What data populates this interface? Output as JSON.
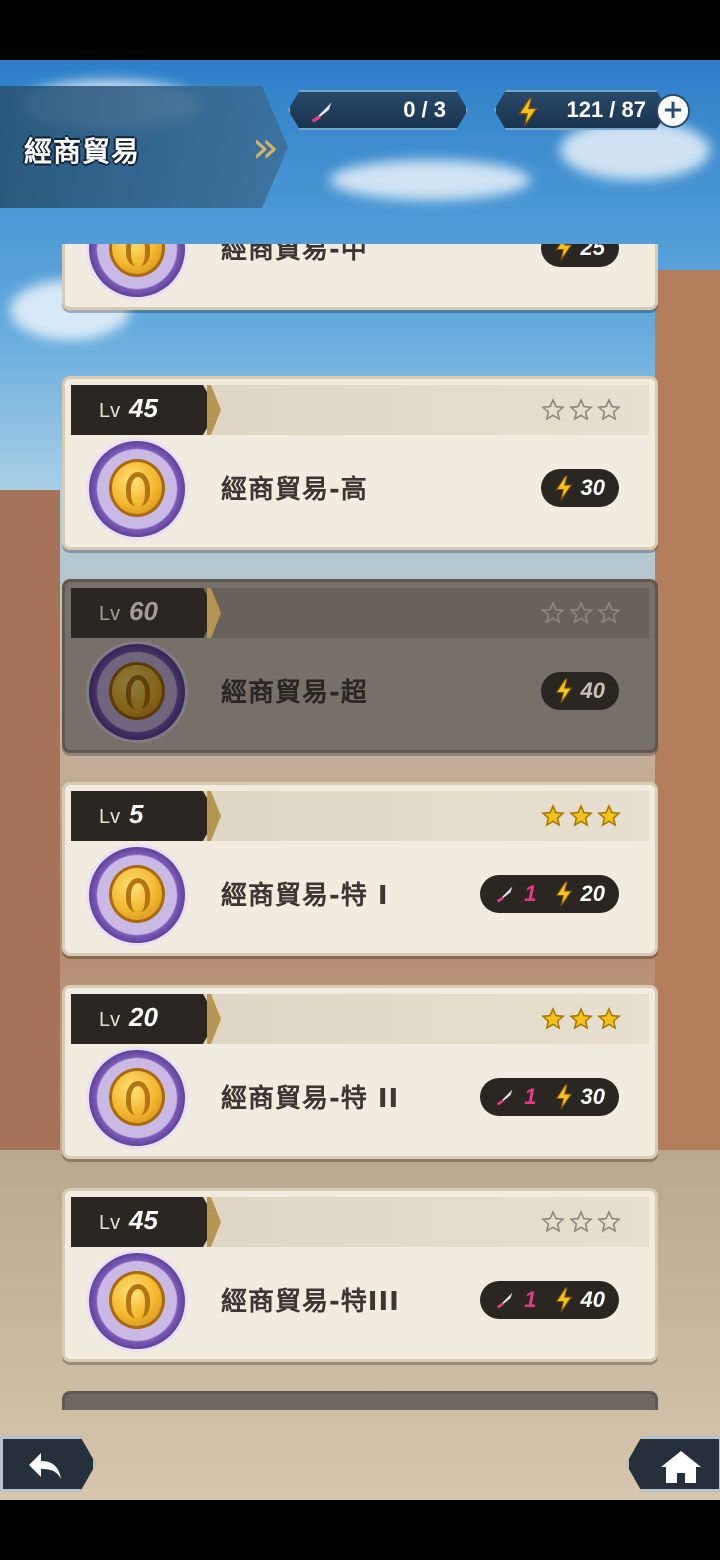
{
  "header": {
    "title": "經商貿易",
    "tickets": "0 / 3",
    "energy": "121 / 87",
    "plus_label": "+"
  },
  "level_prefix": "Lv",
  "stages": [
    {
      "name": "經商貿易-中",
      "level": "",
      "stars": 0,
      "locked": false,
      "energy_cost": "25",
      "ticket_cost": ""
    },
    {
      "name": "經商貿易-高",
      "level": "45",
      "stars": 0,
      "locked": false,
      "energy_cost": "30",
      "ticket_cost": ""
    },
    {
      "name": "經商貿易-超",
      "level": "60",
      "stars": 0,
      "locked": true,
      "energy_cost": "40",
      "ticket_cost": ""
    },
    {
      "name": "經商貿易-特 I",
      "level": "5",
      "stars": 3,
      "locked": false,
      "energy_cost": "20",
      "ticket_cost": "1"
    },
    {
      "name": "經商貿易-特 II",
      "level": "20",
      "stars": 3,
      "locked": false,
      "energy_cost": "30",
      "ticket_cost": "1"
    },
    {
      "name": "經商貿易-特III",
      "level": "45",
      "stars": 0,
      "locked": false,
      "energy_cost": "40",
      "ticket_cost": "1"
    }
  ],
  "colors": {
    "accent_gold": "#b59753",
    "ticket_pink": "#e33d8a",
    "star_gold": "#f5c21b"
  },
  "icons": {
    "ticket": "feather-quill-icon",
    "energy": "lightning-bolt-icon",
    "back": "back-arrow-icon",
    "home": "home-icon"
  }
}
